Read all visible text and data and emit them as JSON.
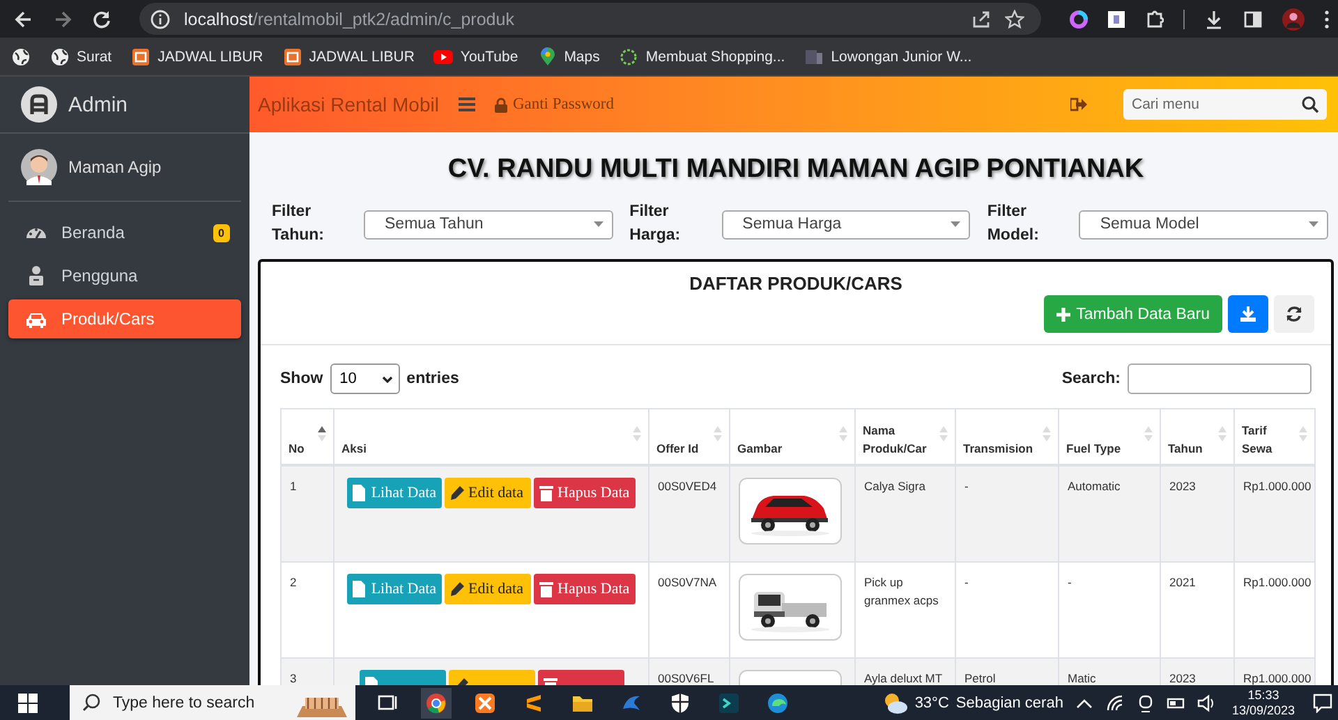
{
  "browser": {
    "url_host": "localhost",
    "url_path": "/rentalmobil_ptk2/admin/c_produk",
    "bookmarks": [
      {
        "kind": "globe"
      },
      {
        "kind": "globe",
        "label": "Surat"
      },
      {
        "kind": "calendar",
        "label": "JADWAL LIBUR"
      },
      {
        "kind": "calendar",
        "label": "JADWAL LIBUR"
      },
      {
        "kind": "video",
        "label": "YouTube"
      },
      {
        "kind": "pin",
        "label": "Maps"
      },
      {
        "kind": "ring",
        "label": "Membuat Shopping..."
      },
      {
        "kind": "page",
        "label": "Lowongan Junior W..."
      }
    ]
  },
  "sidebar": {
    "brand": "Admin",
    "user": "Maman Agip",
    "items": [
      {
        "kind": "gauge",
        "label": "Beranda",
        "badge": "0",
        "selected": false
      },
      {
        "kind": "users",
        "label": "Pengguna",
        "selected": false
      },
      {
        "kind": "car",
        "label": "Produk/Cars",
        "selected": true
      }
    ]
  },
  "header": {
    "app_title": "Aplikasi Rental Mobil",
    "password_link": "Ganti Password",
    "search": {
      "placeholder": "Cari menu"
    }
  },
  "page_title": "CV. RANDU MULTI MANDIRI MAMAN AGIP PONTIANAK",
  "filters": [
    {
      "label": "Filter Tahun:",
      "value": "Semua Tahun"
    },
    {
      "label": "Filter Harga:",
      "value": "Semua Harga"
    },
    {
      "label": "Filter Model:",
      "value": "Semua Model"
    }
  ],
  "card": {
    "title": "DAFTAR PRODUK/CARS",
    "add_button": "Tambah Data Baru",
    "length": {
      "prefix": "Show",
      "value": "10",
      "suffix": "entries"
    },
    "search_label": "Search:",
    "columns": [
      {
        "label": "No",
        "sorted": true
      },
      {
        "label": "Aksi",
        "sorted": false
      },
      {
        "label": "Offer Id",
        "sorted": false
      },
      {
        "label": "Gambar",
        "sorted": false
      },
      {
        "label": "Nama Produk/Car",
        "sorted": false
      },
      {
        "label": "Transmision",
        "sorted": false
      },
      {
        "label": "Fuel Type",
        "sorted": false
      },
      {
        "label": "Tahun",
        "sorted": false
      },
      {
        "label": "Tarif Sewa",
        "sorted": false
      }
    ],
    "rows": [
      {
        "no": "1",
        "actions": [
          {
            "kind": "view",
            "label": "Lihat Data"
          },
          {
            "kind": "edit",
            "label": "Edit data"
          },
          {
            "kind": "delete",
            "label": "Hapus Data"
          }
        ],
        "offer_id": "00S0VED4",
        "name": "Calya Sigra",
        "transmission": "-",
        "fuel": "Automatic",
        "year": "2023",
        "price": "Rp1.000.000"
      },
      {
        "no": "2",
        "actions": [
          {
            "kind": "view",
            "label": "Lihat Data"
          },
          {
            "kind": "edit",
            "label": "Edit data"
          },
          {
            "kind": "delete",
            "label": "Hapus Data"
          }
        ],
        "offer_id": "00S0V7NA",
        "name": "Pick up granmex acps",
        "transmission": "-",
        "fuel": "-",
        "year": "2021",
        "price": "Rp1.000.000"
      },
      {
        "no": "3",
        "actions": [
          {
            "kind": "view"
          },
          {
            "kind": "edit"
          },
          {
            "kind": "delete"
          }
        ],
        "offer_id": "00S0V6FL",
        "name": "Ayla deluxt MT",
        "transmission": "Petrol",
        "fuel": "Matic",
        "year": "2023",
        "price": "Rp1.000.000"
      }
    ]
  },
  "taskbar": {
    "search_placeholder": "Type here to search",
    "temperature": "33°C",
    "weather": "Sebagian cerah",
    "time": "15:33",
    "date": "13/09/2023"
  }
}
